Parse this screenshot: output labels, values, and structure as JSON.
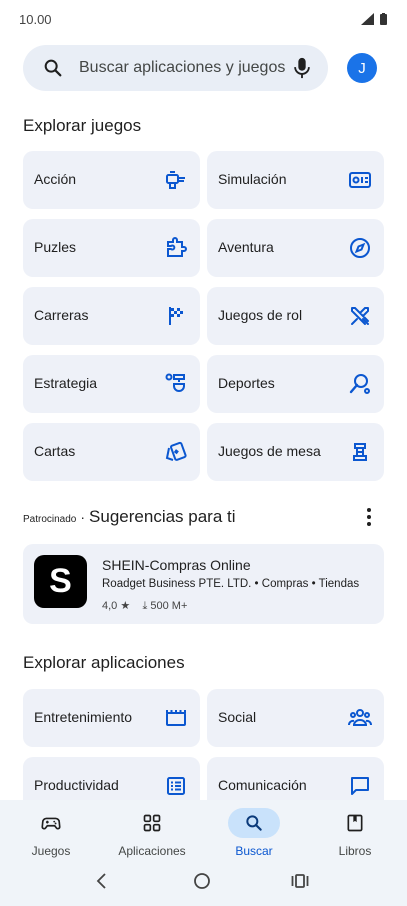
{
  "status": {
    "time": "10.00"
  },
  "search": {
    "placeholder": "Buscar aplicaciones y juegos",
    "avatar_letter": "J"
  },
  "explore_games": {
    "title": "Explorar juegos",
    "categories": [
      {
        "label": "Acción",
        "icon": "controller-icon"
      },
      {
        "label": "Simulación",
        "icon": "simulation-icon"
      },
      {
        "label": "Puzles",
        "icon": "puzzle-icon"
      },
      {
        "label": "Aventura",
        "icon": "compass-icon"
      },
      {
        "label": "Carreras",
        "icon": "checkered-flag-icon"
      },
      {
        "label": "Juegos de rol",
        "icon": "swords-icon"
      },
      {
        "label": "Estrategia",
        "icon": "strategy-icon"
      },
      {
        "label": "Deportes",
        "icon": "sports-icon"
      },
      {
        "label": "Cartas",
        "icon": "cards-icon"
      },
      {
        "label": "Juegos de mesa",
        "icon": "chess-piece-icon"
      }
    ]
  },
  "suggestions": {
    "sponsored_label": "Patrocinado",
    "separator": "·",
    "title": "Sugerencias para ti",
    "ad": {
      "logo_letter": "S",
      "name": "SHEIN-Compras Online",
      "developer": "Roadget Business PTE. LTD. • Compras • Tiendas",
      "rating": "4,0 ★",
      "downloads": "⤓ 500 M+"
    }
  },
  "explore_apps": {
    "title": "Explorar aplicaciones",
    "categories": [
      {
        "label": "Entretenimiento",
        "icon": "clapperboard-icon"
      },
      {
        "label": "Social",
        "icon": "people-icon"
      },
      {
        "label": "Productividad",
        "icon": "checklist-icon"
      },
      {
        "label": "Comunicación",
        "icon": "chat-icon"
      }
    ]
  },
  "bottom_nav": {
    "items": [
      {
        "label": "Juegos",
        "icon": "gamepad-icon",
        "active": false
      },
      {
        "label": "Aplicaciones",
        "icon": "apps-grid-icon",
        "active": false
      },
      {
        "label": "Buscar",
        "icon": "search-icon",
        "active": true
      },
      {
        "label": "Libros",
        "icon": "book-icon",
        "active": false
      }
    ]
  },
  "colors": {
    "accent": "#0b57d0",
    "card_bg": "#eef1f8",
    "search_bg": "#e9eef6",
    "nav_bg": "#f0f4f9"
  }
}
